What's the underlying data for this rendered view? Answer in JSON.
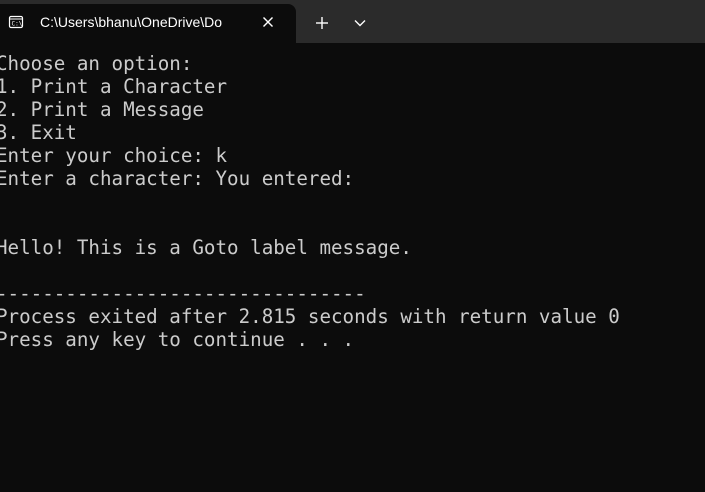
{
  "tab": {
    "title": "C:\\Users\\bhanu\\OneDrive\\Do",
    "icon": "terminal-icon"
  },
  "titlebar_icons": {
    "close": "close-icon",
    "new_tab": "plus-icon",
    "dropdown": "chevron-down-icon"
  },
  "console": {
    "lines": [
      "Choose an option:",
      "1. Print a Character",
      "2. Print a Message",
      "3. Exit",
      "Enter your choice: k",
      "Enter a character: You entered:",
      "Hello! This is a Goto label message.",
      "--------------------------------",
      "Process exited after 2.815 seconds with return value 0",
      "Press any key to continue . . ."
    ]
  },
  "colors": {
    "background": "#0c0c0c",
    "titlebar": "#2b2b2b",
    "text": "#cccccc"
  }
}
